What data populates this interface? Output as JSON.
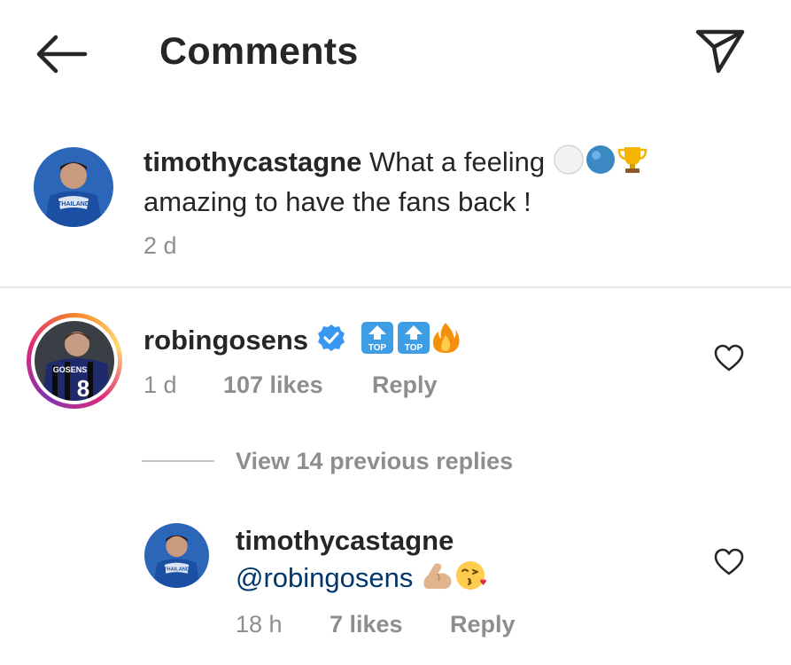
{
  "header": {
    "title": "Comments",
    "back_icon": "arrow-left-icon",
    "send_icon": "paper-plane-icon"
  },
  "caption": {
    "username": "timothycastagne",
    "text_line1": "What a feeling",
    "text_line2": "amazing to have the fans back !",
    "emojis": [
      "white-circle",
      "blue-circle",
      "trophy"
    ],
    "time": "2 d",
    "avatar_jersey_text": "THAILAND"
  },
  "comment": {
    "username": "robingosens",
    "verified": true,
    "emojis": [
      "top-arrow",
      "top-arrow",
      "fire"
    ],
    "top_label": "TOP",
    "time": "1 d",
    "likes": "107 likes",
    "reply_label": "Reply",
    "avatar_jersey_name": "GOSENS",
    "avatar_jersey_number": "8"
  },
  "view_replies": "View 14 previous replies",
  "reply": {
    "username": "timothycastagne",
    "mention": "@robingosens",
    "emojis": [
      "flexed-biceps",
      "kissing-face"
    ],
    "time": "18 h",
    "likes": "7 likes",
    "reply_label": "Reply",
    "avatar_jersey_text": "THAILAND"
  },
  "colors": {
    "text": "#262626",
    "secondary": "#8e8e8e",
    "verified_blue": "#3897f0",
    "mention": "#00376b"
  }
}
